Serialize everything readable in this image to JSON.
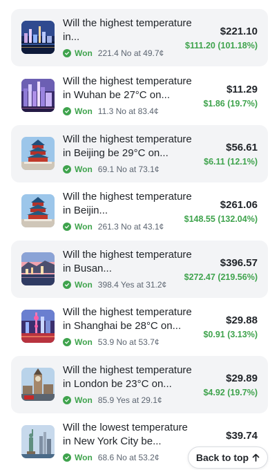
{
  "positions": [
    {
      "title": "Will the highest temperature in...",
      "status": "Won",
      "detail": "221.4 No at 49.7¢",
      "amount": "$221.10",
      "pnl": "$111.20 (101.18%)",
      "image_icon": "night-city-skyline-image",
      "shaded": true
    },
    {
      "title": "Will the highest temperature in Wuhan be 27°C on...",
      "status": "Won",
      "detail": "11.3 No at 83.4¢",
      "amount": "$11.29",
      "pnl": "$1.86 (19.7%)",
      "image_icon": "wuhan-skyline-image",
      "shaded": false
    },
    {
      "title": "Will the highest temperature in Beijing be 29°C on...",
      "status": "Won",
      "detail": "69.1 No at 73.1¢",
      "amount": "$56.61",
      "pnl": "$6.11 (12.1%)",
      "image_icon": "temple-of-heaven-image",
      "shaded": true
    },
    {
      "title": "Will the highest temperature in Beijin...",
      "status": "Won",
      "detail": "261.3 No at 43.1¢",
      "amount": "$261.06",
      "pnl": "$148.55 (132.04%)",
      "image_icon": "temple-of-heaven-image",
      "shaded": false
    },
    {
      "title": "Will the highest temperature in Busan...",
      "status": "Won",
      "detail": "398.4 Yes at 31.2¢",
      "amount": "$396.57",
      "pnl": "$272.47 (219.56%)",
      "image_icon": "busan-coast-image",
      "shaded": true
    },
    {
      "title": "Will the highest temperature in Shanghai be 28°C on...",
      "status": "Won",
      "detail": "53.9 No at 53.7¢",
      "amount": "$29.88",
      "pnl": "$0.91 (3.13%)",
      "image_icon": "shanghai-tower-image",
      "shaded": false
    },
    {
      "title": "Will the highest temperature in London be 23°C on...",
      "status": "Won",
      "detail": "85.9 Yes at 29.1¢",
      "amount": "$29.89",
      "pnl": "$4.92 (19.7%)",
      "image_icon": "big-ben-image",
      "shaded": true
    },
    {
      "title": "Will the lowest temperature in New York City be...",
      "status": "Won",
      "detail": "68.6 No at 53.2¢",
      "amount": "$39.74",
      "pnl": "",
      "image_icon": "statue-of-liberty-image",
      "shaded": false
    }
  ],
  "back_to_top": {
    "label": "Back to top",
    "icon": "arrow-up-icon"
  },
  "colors": {
    "won_green": "#3fa34d",
    "card_shade": "#f3f4f6",
    "text_primary": "#1f2328",
    "text_secondary": "#5b6470"
  }
}
